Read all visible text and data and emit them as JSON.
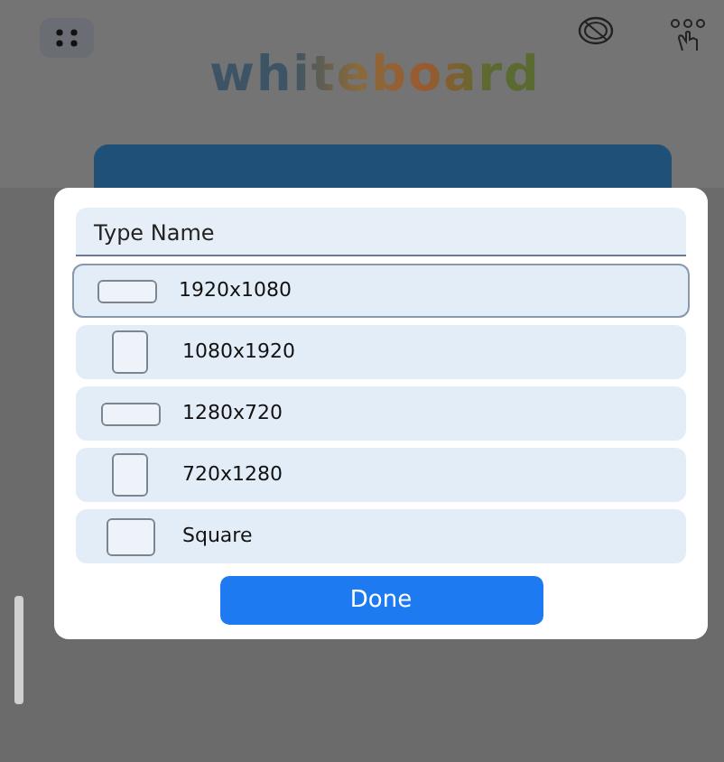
{
  "app": {
    "title": "whiteboard"
  },
  "dialog": {
    "header": "Type Name",
    "options": [
      {
        "label": "1920x1080",
        "kind": "landscape",
        "selected": true
      },
      {
        "label": "1080x1920",
        "kind": "portrait",
        "selected": false
      },
      {
        "label": "1280x720",
        "kind": "landscape",
        "selected": false
      },
      {
        "label": "720x1280",
        "kind": "portrait",
        "selected": false
      },
      {
        "label": "Square",
        "kind": "square",
        "selected": false
      }
    ],
    "done": "Done"
  }
}
